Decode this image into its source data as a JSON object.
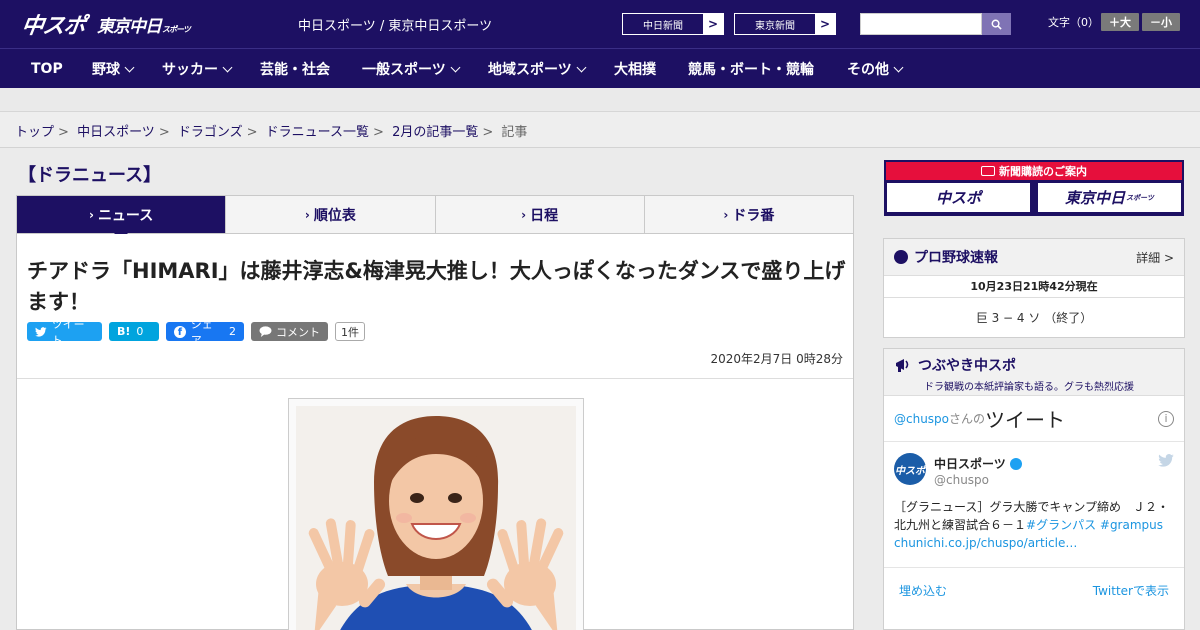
{
  "header": {
    "logo_main": "中スポ",
    "logo_sub": "東京中日",
    "logo_sub_small": "スポーツ",
    "site_name": "中日スポーツ / 東京中日スポーツ",
    "paper_links": [
      {
        "label": "中日新聞",
        "arrow": ">"
      },
      {
        "label": "東京新聞",
        "arrow": ">"
      }
    ],
    "search": {
      "value": "",
      "icon": "search-icon"
    },
    "font_size_label": "文字（0）",
    "font_bigger": "＋大",
    "font_smaller": "－小"
  },
  "nav": {
    "items": [
      {
        "label": "TOP",
        "has_menu": false
      },
      {
        "label": "野球",
        "has_menu": true
      },
      {
        "label": "サッカー",
        "has_menu": true
      },
      {
        "label": "芸能・社会",
        "has_menu": false
      },
      {
        "label": "一般スポーツ",
        "has_menu": true
      },
      {
        "label": "地域スポーツ",
        "has_menu": true
      },
      {
        "label": "大相撲",
        "has_menu": false
      },
      {
        "label": "競馬・ボート・競輪",
        "has_menu": false
      },
      {
        "label": "その他",
        "has_menu": true
      }
    ]
  },
  "breadcrumb": {
    "items": [
      "トップ",
      "中日スポーツ",
      "ドラゴンズ",
      "ドラニュース一覧",
      "2月の記事一覧"
    ],
    "current": "記事",
    "separator": ">"
  },
  "category_heading": "【ドラニュース】",
  "tabs": [
    {
      "label": "ニュース",
      "active": true
    },
    {
      "label": "順位表",
      "active": false
    },
    {
      "label": "日程",
      "active": false
    },
    {
      "label": "ドラ番",
      "active": false
    }
  ],
  "article": {
    "headline": "チアドラ「HIMARI」は藤井淳志&梅津晃大推し！大人っぽくなったダンスで盛り上げます！",
    "share": {
      "tweet": "ツイート",
      "hatena_icon": "B!",
      "hatena_count": "0",
      "facebook": "シェア",
      "facebook_count": "2",
      "comment": "コメント",
      "comment_count": "1件"
    },
    "date": "2020年2月7日 0時28分"
  },
  "sidebar": {
    "subscribe": {
      "title": "新聞購読のご案内",
      "left": "中スポ",
      "right": "東京中日",
      "right_small": "スポーツ"
    },
    "pro_baseball": {
      "title": "プロ野球速報",
      "more": "詳細 >",
      "updated": "10月23日21時42分現在",
      "score": "巨 3 − 4 ソ （終了）"
    },
    "tsubuyaki": {
      "title": "つぶやき中スポ",
      "subtitle": "ドラ観戦の本紙評論家も語る。グラも熱烈応援",
      "handle_link": "@chuspo",
      "handle_suffix": "さんの",
      "tweets_label": "ツイート",
      "info_icon": "i",
      "tweet": {
        "avatar": "中スポ",
        "name": "中日スポーツ",
        "handle": "@chuspo",
        "text": "［グラニュース］グラ大勝でキャンプ締め　Ｊ２・北九州と練習試合６－１",
        "hashtags": "#グランパス #grampus",
        "link": "chunichi.co.jp/chuspo/article…"
      },
      "embed": "埋め込む",
      "view_on": "Twitterで表示"
    }
  },
  "colors": {
    "brand_navy": "#1d1063",
    "subscribe_red": "#e60f3c",
    "twitter_blue": "#1da1f2",
    "facebook_blue": "#1877f2",
    "hatena_blue": "#00a4de"
  }
}
